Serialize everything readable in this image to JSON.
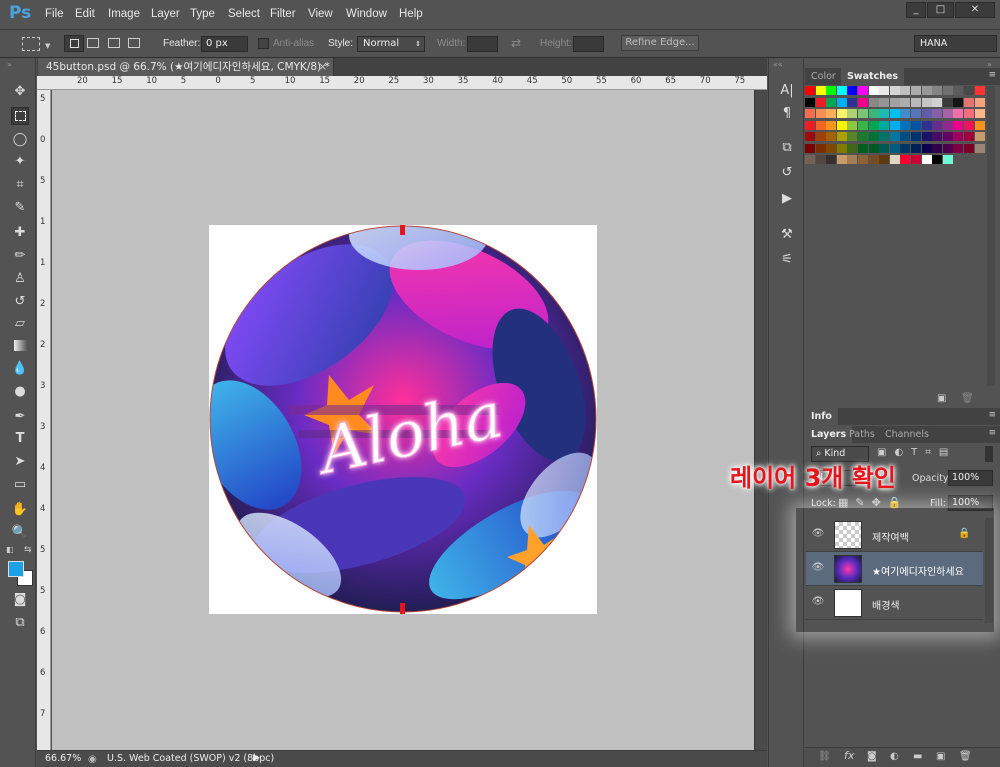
{
  "app": {
    "logo": "Ps",
    "user": "HANA"
  },
  "menu": [
    "File",
    "Edit",
    "Image",
    "Layer",
    "Type",
    "Select",
    "Filter",
    "View",
    "Window",
    "Help"
  ],
  "window_buttons": [
    "_",
    "□",
    "✕"
  ],
  "options": {
    "feather_label": "Feather:",
    "feather_value": "0 px",
    "antialias_label": "Anti-alias",
    "style_label": "Style:",
    "style_value": "Normal",
    "width_label": "Width:",
    "height_label": "Height:",
    "refine_label": "Refine Edge..."
  },
  "document": {
    "tab_title": "45button.psd @ 66.7% (★여기에디자인하세요, CMYK/8) *",
    "ruler_top": [
      "20",
      "15",
      "10",
      "5",
      "0",
      "5",
      "10",
      "15",
      "20",
      "25",
      "30",
      "35",
      "40",
      "45",
      "50",
      "55",
      "60",
      "65",
      "70",
      "75"
    ],
    "ruler_left": [
      "5",
      "0",
      "5",
      "1",
      "1",
      "2",
      "2",
      "3",
      "3",
      "4",
      "4",
      "5",
      "5",
      "6",
      "6",
      "7"
    ],
    "artwork_text": "Aloha"
  },
  "status": {
    "zoom": "66.67%",
    "profile": "U.S. Web Coated (SWOP) v2 (8bpc)"
  },
  "color_panel": {
    "tabs": [
      "Color",
      "Swatches"
    ],
    "active": "Swatches"
  },
  "swatches": [
    [
      "#ff0000",
      "#ffff00",
      "#00ff00",
      "#00ffff",
      "#0000ff",
      "#ff00ff",
      "#ffffff",
      "#e8e8e8",
      "#d4d4d4",
      "#c0c0c0",
      "#acacac",
      "#989898",
      "#848484",
      "#707070",
      "#5c5c5c",
      "#484848",
      "#ff3333"
    ],
    [
      "#000000",
      "#ed1c24",
      "#00a651",
      "#00aeef",
      "#2e3192",
      "#ec008c",
      "#898989",
      "#959595",
      "#a1a1a1",
      "#adadad",
      "#b9b9b9",
      "#c5c5c5",
      "#d1d1d1",
      "#3a3a3a",
      "#141414",
      "#e57373",
      "#f6a47f"
    ],
    [
      "#f26c4f",
      "#f68e55",
      "#fbaf5c",
      "#fff467",
      "#acd372",
      "#7cc576",
      "#3bb878",
      "#1abbb4",
      "#00bff3",
      "#438ccb",
      "#5574b9",
      "#605ca8",
      "#855fa8",
      "#a763a8",
      "#f06ea9",
      "#f26d7d",
      "#ffb78c"
    ],
    [
      "#ed1c24",
      "#f26522",
      "#f7941d",
      "#fff200",
      "#8dc63f",
      "#39b54a",
      "#00a651",
      "#00a99d",
      "#00aeef",
      "#0072bc",
      "#0054a6",
      "#2e3192",
      "#662d91",
      "#92278f",
      "#ec008c",
      "#ed145b",
      "#f7941d"
    ],
    [
      "#9e0b0f",
      "#a0410d",
      "#a36209",
      "#aba000",
      "#598527",
      "#1a7b30",
      "#007236",
      "#00746b",
      "#0076a3",
      "#004b80",
      "#003471",
      "#1b1464",
      "#440e62",
      "#630460",
      "#9e005d",
      "#9e0039",
      "#c69c6d"
    ],
    [
      "#790000",
      "#7b2e00",
      "#7d4900",
      "#827b00",
      "#406618",
      "#005e20",
      "#005826",
      "#005952",
      "#005b7f",
      "#003663",
      "#002157",
      "#0d004c",
      "#32004b",
      "#4b0049",
      "#7b0046",
      "#7a0026",
      "#998675"
    ],
    [
      "#736357",
      "#534741",
      "#362f2d",
      "#c69c6d",
      "#a67c52",
      "#8c6239",
      "#754c24",
      "#603913",
      "#e0d5c1",
      "#ff0033",
      "#cc0033",
      "#ffffff",
      "#000000",
      "#6ff7d6"
    ]
  ],
  "info_panel": {
    "tab": "Info"
  },
  "layers_panel": {
    "tabs": [
      "Layers",
      "Paths",
      "Channels"
    ],
    "kind": "Kind",
    "opacity_label": "Opacity:",
    "opacity_value": "100%",
    "lock_label": "Lock:",
    "fill_label": "Fill:",
    "fill_value": "100%",
    "layers": [
      {
        "name": "제작여백",
        "locked": true,
        "selected": false
      },
      {
        "name": "★여기에디자인하세요",
        "locked": false,
        "selected": true
      },
      {
        "name": "배경색",
        "locked": false,
        "selected": false
      }
    ]
  },
  "annotation": {
    "text": "레이어 3개 확인",
    "color": "#e8141c"
  }
}
